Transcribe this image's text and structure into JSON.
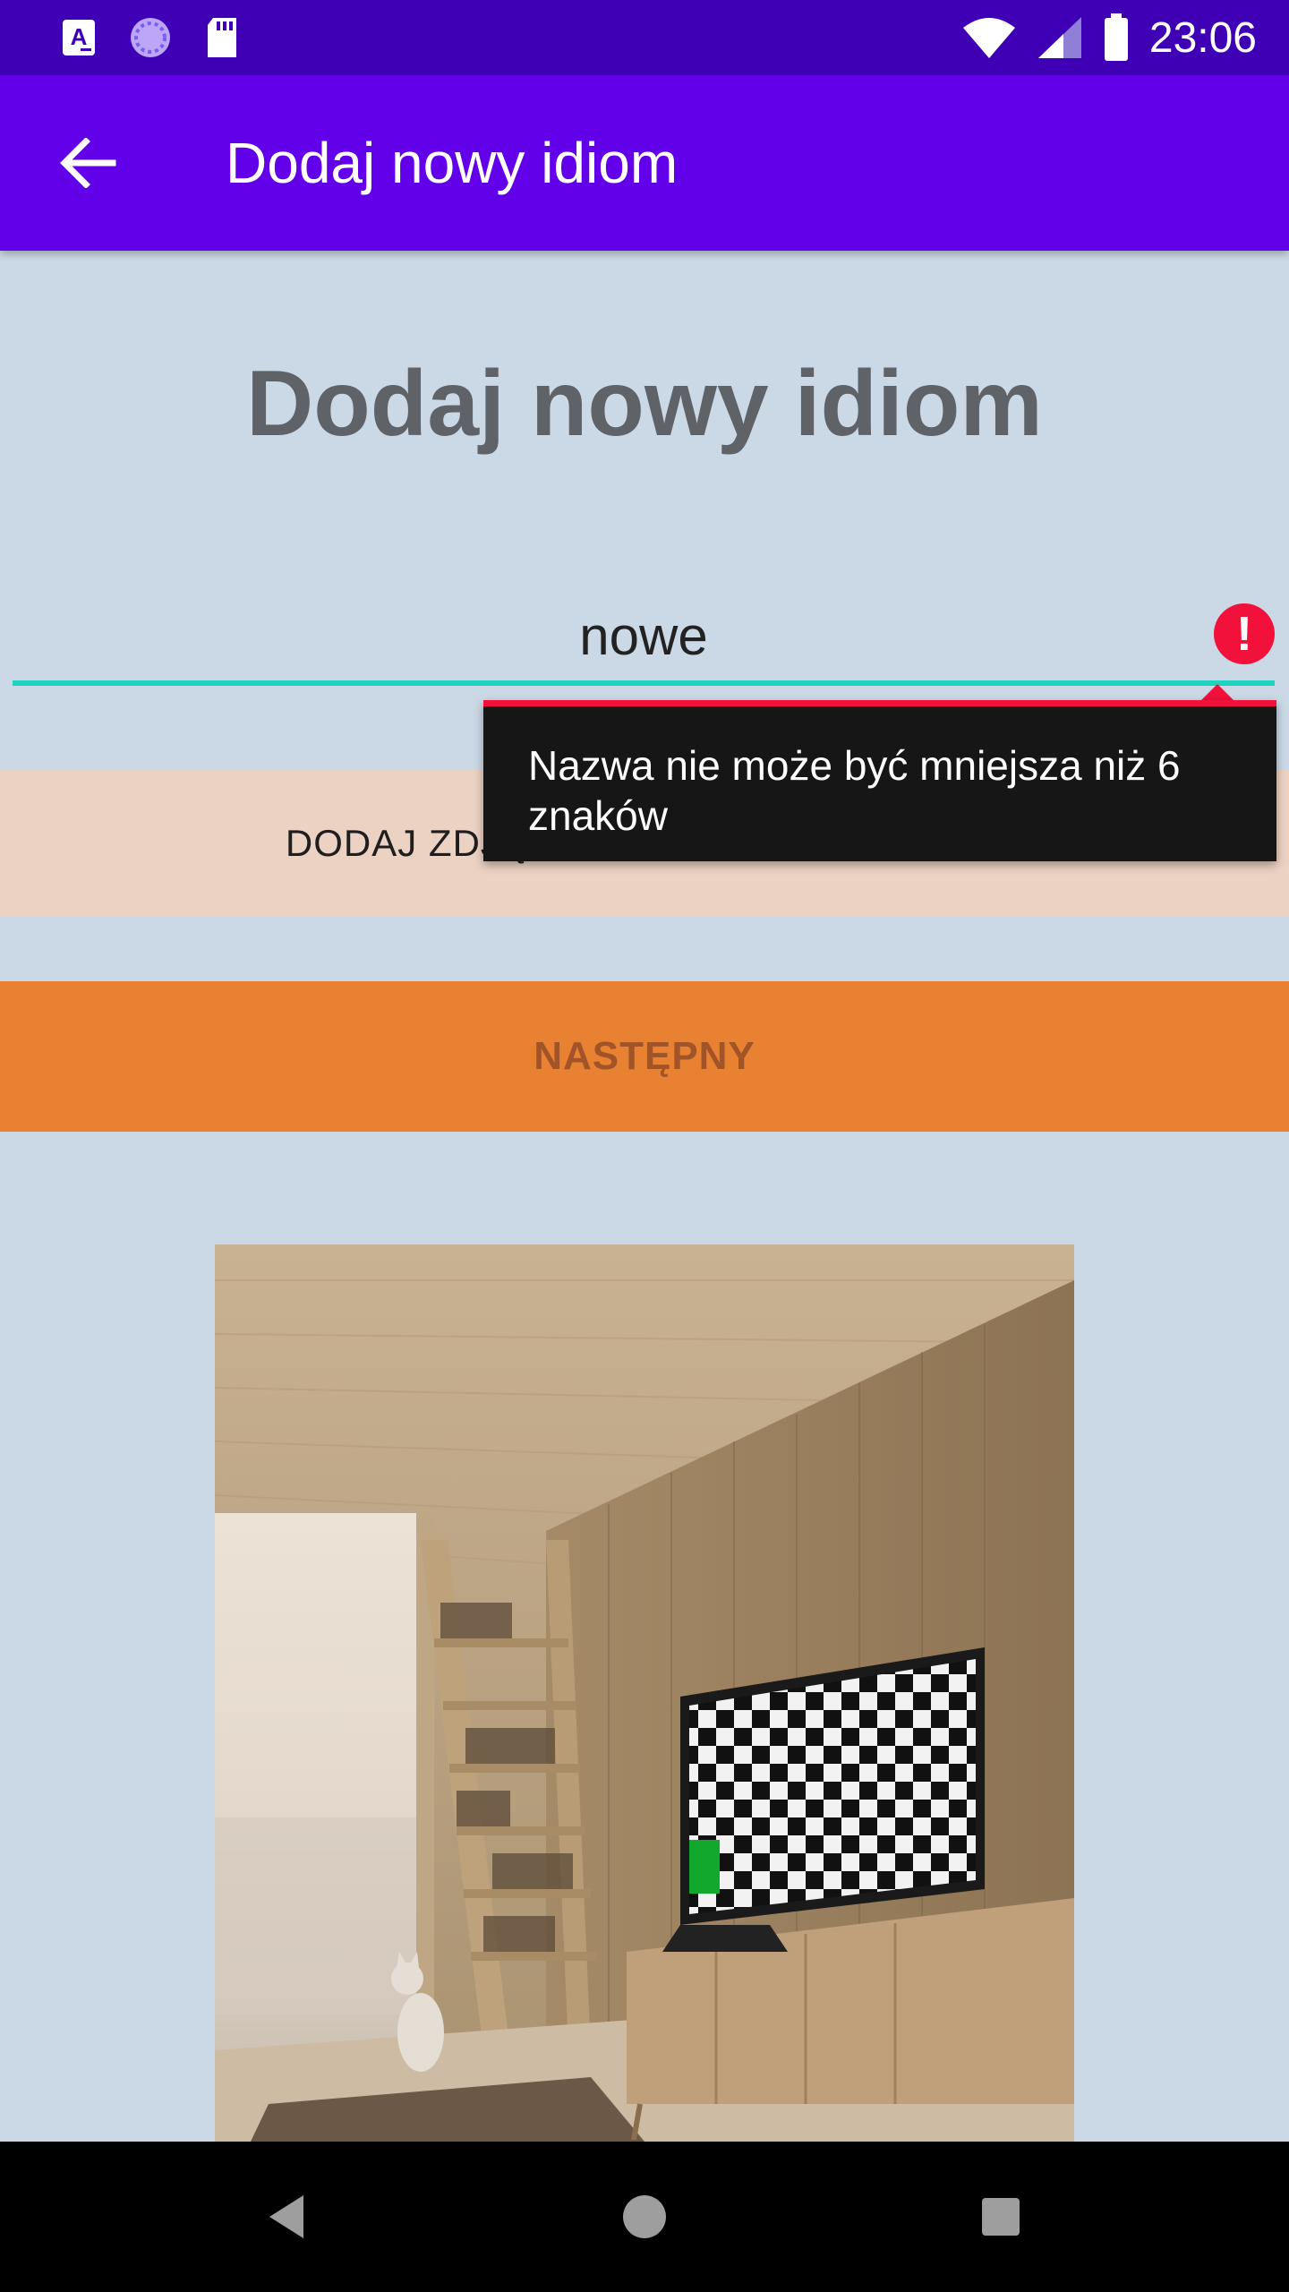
{
  "status_bar": {
    "time": "23:06",
    "icons": [
      "font-app-icon",
      "loading-app-icon",
      "sd-card-icon",
      "wifi-icon",
      "signal-icon",
      "battery-icon"
    ]
  },
  "app_bar": {
    "title": "Dodaj nowy idiom",
    "back_icon": "arrow-left-icon"
  },
  "form": {
    "heading": "Dodaj nowy idiom",
    "name_value": "nowe",
    "error_message": "Nazwa nie może być mniejsza niż 6 znaków",
    "gallery_button": "DODAJ ZDJĘCIE Z LOKALNEJ GALERII",
    "next_button": "NASTĘPNY"
  },
  "nav_bar": {
    "buttons": [
      "back-triangle-icon",
      "home-circle-icon",
      "recents-square-icon"
    ]
  },
  "colors": {
    "status_bar": "#3f00b5",
    "app_bar": "#6200ea",
    "background": "#cbd9e7",
    "input_underline": "#1ed3c0",
    "error": "#f2113b",
    "gallery_button": "#ecd2c3",
    "next_button": "#e88132"
  }
}
